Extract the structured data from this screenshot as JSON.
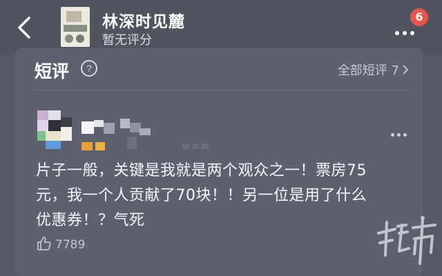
{
  "header": {
    "title": "林深时见麓",
    "rating_text": "暂无评分",
    "notification_count": "6"
  },
  "section": {
    "title": "短评",
    "all_link": "全部短评 7"
  },
  "comment": {
    "text_lines": [
      "片子一般，关键是我就是两个观众之一！票房75",
      "元，我一个人贡献了70块！！另一位是用了什么",
      "优惠券！？气死"
    ],
    "likes": "7789"
  },
  "colors": {
    "background": "#555a66",
    "card": "#5c616d",
    "badge": "#e8534a",
    "text": "#f2f3f5"
  },
  "icons": [
    "back-arrow-icon",
    "more-dots-icon",
    "help-circle-icon",
    "chevron-right-icon",
    "thumbs-up-icon",
    "more-dots-icon"
  ]
}
